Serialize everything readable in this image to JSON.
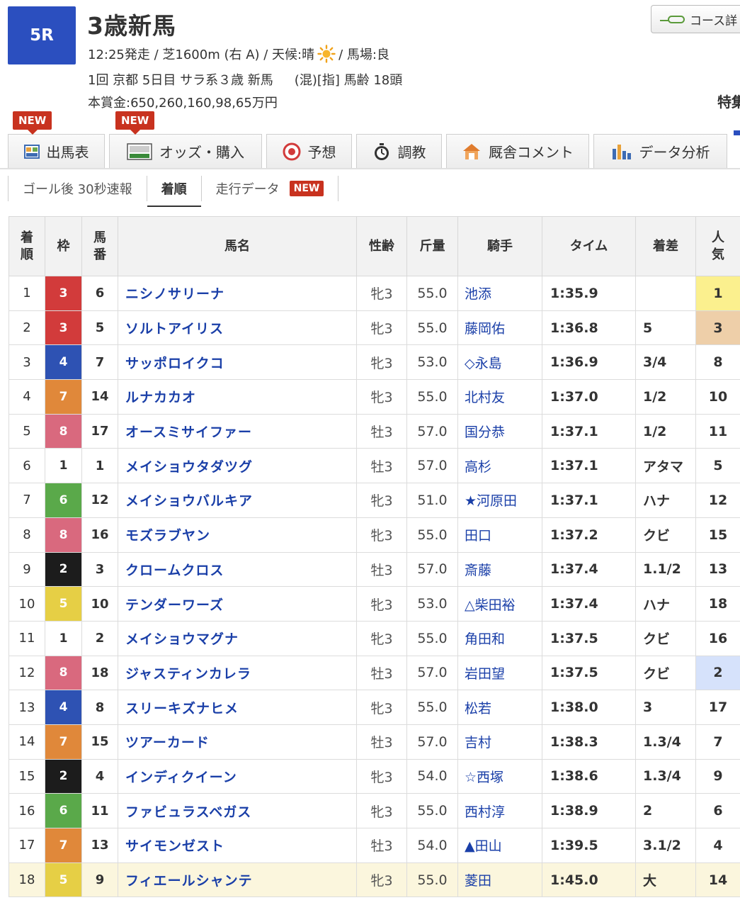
{
  "race": {
    "number": "5R",
    "title": "3歳新馬",
    "start": "12:25発走 / 芝1600m (右 A) / 天候:晴",
    "track": "/ 馬場:良",
    "meeting": "1回 京都 5日目 サラ系３歳 新馬",
    "conditions": "(混)[指] 馬齢 18頭",
    "prize": "本賞金:650,260,160,98,65万円"
  },
  "header": {
    "course_button": "コース詳",
    "tokushu": "特集"
  },
  "tabs": [
    {
      "label": "出馬表",
      "badge": "NEW"
    },
    {
      "label": "オッズ・購入",
      "badge": "NEW"
    },
    {
      "label": "予想"
    },
    {
      "label": "調教"
    },
    {
      "label": "厩舎コメント"
    },
    {
      "label": "データ分析"
    }
  ],
  "subtabs": [
    {
      "label": "ゴール後 30秒速報"
    },
    {
      "label": "着順"
    },
    {
      "label": "走行データ",
      "badge": "NEW"
    }
  ],
  "table": {
    "headers": [
      "着順",
      "枠",
      "馬番",
      "馬名",
      "性齢",
      "斤量",
      "騎手",
      "タイム",
      "着差",
      "人気"
    ],
    "frame_colors": {
      "1": "#ffffff",
      "2": "#1c1c1c",
      "3": "#d23b3b",
      "4": "#2e52b3",
      "5": "#e6cf45",
      "6": "#5aa94a",
      "7": "#e0883a",
      "8": "#d9697e"
    },
    "popularity_highlight": {
      "1": "#fbf08e",
      "2": "#d6e2fb",
      "3": "#eecfa9"
    },
    "rows": [
      {
        "rank": "1",
        "frame": "3",
        "num": "6",
        "horse": "ニシノサリーナ",
        "sex": "牝3",
        "weight": "55.0",
        "jockey": "池添",
        "time": "1:35.9",
        "margin": "",
        "pop": "1"
      },
      {
        "rank": "2",
        "frame": "3",
        "num": "5",
        "horse": "ソルトアイリス",
        "sex": "牝3",
        "weight": "55.0",
        "jockey": "藤岡佑",
        "time": "1:36.8",
        "margin": "5",
        "pop": "3"
      },
      {
        "rank": "3",
        "frame": "4",
        "num": "7",
        "horse": "サッポロイクコ",
        "sex": "牝3",
        "weight": "53.0",
        "jockey": "◇永島",
        "time": "1:36.9",
        "margin": "3/4",
        "pop": "8"
      },
      {
        "rank": "4",
        "frame": "7",
        "num": "14",
        "horse": "ルナカカオ",
        "sex": "牝3",
        "weight": "55.0",
        "jockey": "北村友",
        "time": "1:37.0",
        "margin": "1/2",
        "pop": "10"
      },
      {
        "rank": "5",
        "frame": "8",
        "num": "17",
        "horse": "オースミサイファー",
        "sex": "牡3",
        "weight": "57.0",
        "jockey": "国分恭",
        "time": "1:37.1",
        "margin": "1/2",
        "pop": "11"
      },
      {
        "rank": "6",
        "frame": "1",
        "num": "1",
        "horse": "メイショウタダツグ",
        "sex": "牡3",
        "weight": "57.0",
        "jockey": "高杉",
        "time": "1:37.1",
        "margin": "アタマ",
        "pop": "5"
      },
      {
        "rank": "7",
        "frame": "6",
        "num": "12",
        "horse": "メイショウバルキア",
        "sex": "牝3",
        "weight": "51.0",
        "jockey": "★河原田",
        "time": "1:37.1",
        "margin": "ハナ",
        "pop": "12"
      },
      {
        "rank": "8",
        "frame": "8",
        "num": "16",
        "horse": "モズラブヤン",
        "sex": "牝3",
        "weight": "55.0",
        "jockey": "田口",
        "time": "1:37.2",
        "margin": "クビ",
        "pop": "15"
      },
      {
        "rank": "9",
        "frame": "2",
        "num": "3",
        "horse": "クロームクロス",
        "sex": "牡3",
        "weight": "57.0",
        "jockey": "斎藤",
        "time": "1:37.4",
        "margin": "1.1/2",
        "pop": "13"
      },
      {
        "rank": "10",
        "frame": "5",
        "num": "10",
        "horse": "テンダーワーズ",
        "sex": "牝3",
        "weight": "53.0",
        "jockey": "△柴田裕",
        "time": "1:37.4",
        "margin": "ハナ",
        "pop": "18"
      },
      {
        "rank": "11",
        "frame": "1",
        "num": "2",
        "horse": "メイショウマグナ",
        "sex": "牝3",
        "weight": "55.0",
        "jockey": "角田和",
        "time": "1:37.5",
        "margin": "クビ",
        "pop": "16"
      },
      {
        "rank": "12",
        "frame": "8",
        "num": "18",
        "horse": "ジャスティンカレラ",
        "sex": "牡3",
        "weight": "57.0",
        "jockey": "岩田望",
        "time": "1:37.5",
        "margin": "クビ",
        "pop": "2"
      },
      {
        "rank": "13",
        "frame": "4",
        "num": "8",
        "horse": "スリーキズナヒメ",
        "sex": "牝3",
        "weight": "55.0",
        "jockey": "松若",
        "time": "1:38.0",
        "margin": "3",
        "pop": "17"
      },
      {
        "rank": "14",
        "frame": "7",
        "num": "15",
        "horse": "ツアーカード",
        "sex": "牡3",
        "weight": "57.0",
        "jockey": "吉村",
        "time": "1:38.3",
        "margin": "1.3/4",
        "pop": "7"
      },
      {
        "rank": "15",
        "frame": "2",
        "num": "4",
        "horse": "インディクイーン",
        "sex": "牝3",
        "weight": "54.0",
        "jockey": "☆西塚",
        "time": "1:38.6",
        "margin": "1.3/4",
        "pop": "9"
      },
      {
        "rank": "16",
        "frame": "6",
        "num": "11",
        "horse": "ファビュラスベガス",
        "sex": "牝3",
        "weight": "55.0",
        "jockey": "西村淳",
        "time": "1:38.9",
        "margin": "2",
        "pop": "6"
      },
      {
        "rank": "17",
        "frame": "7",
        "num": "13",
        "horse": "サイモンゼスト",
        "sex": "牡3",
        "weight": "54.0",
        "jockey": "▲田山",
        "time": "1:39.5",
        "margin": "3.1/2",
        "pop": "4"
      },
      {
        "rank": "18",
        "frame": "5",
        "num": "9",
        "horse": "フィエールシャンテ",
        "sex": "牝3",
        "weight": "55.0",
        "jockey": "菱田",
        "time": "1:45.0",
        "margin": "大",
        "pop": "14"
      }
    ]
  }
}
